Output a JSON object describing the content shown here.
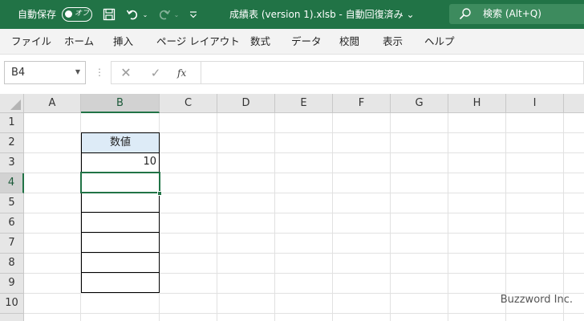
{
  "titlebar": {
    "autosave_label": "自動保存",
    "autosave_toggle": "オフ",
    "document_title": "成績表 (version 1).xlsb  -  自動回復済み  ⌄",
    "search_placeholder": "検索 (Alt+Q)",
    "accent_color": "#217346"
  },
  "ribbon": {
    "tabs": [
      "ファイル",
      "ホーム",
      "挿入",
      "ページ レイアウト",
      "数式",
      "データ",
      "校閲",
      "表示",
      "ヘルプ"
    ]
  },
  "formula_bar": {
    "name_box": "B4",
    "fx_label": "fx",
    "formula": ""
  },
  "grid": {
    "columns": [
      "A",
      "B",
      "C",
      "D",
      "E",
      "F",
      "G",
      "H",
      "I"
    ],
    "rows": [
      "1",
      "2",
      "3",
      "4",
      "5",
      "6",
      "7",
      "8",
      "9",
      "10"
    ],
    "selected_column": "B",
    "selected_row": "4",
    "table": {
      "header": "数値",
      "value_row3": "10"
    }
  },
  "watermark": "Buzzword Inc."
}
